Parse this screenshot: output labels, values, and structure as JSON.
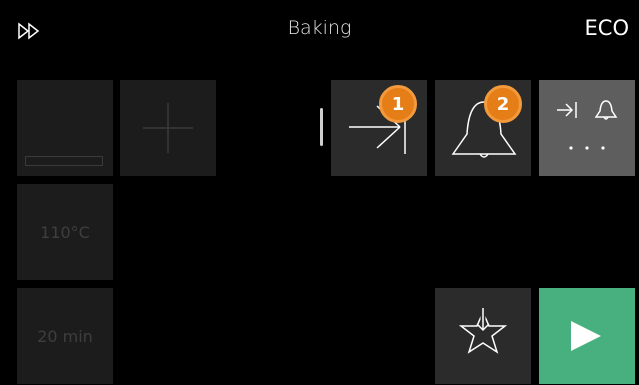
{
  "header": {
    "title": "Baking",
    "eco_label": "ECO",
    "fast_forward_icon": "fast-forward-icon"
  },
  "settings": {
    "temperature": "110°C",
    "duration": "20 min"
  },
  "badges": {
    "first": "1",
    "second": "2"
  },
  "actions": {
    "end_time_icon": "arrow-to-line-icon",
    "alarm_icon": "bell-icon",
    "more_options_icons": [
      "arrow-to-line-icon",
      "bell-icon"
    ],
    "favourite_icon": "star-download-icon",
    "start_icon": "play-icon"
  },
  "colors": {
    "background": "#000000",
    "tile_dark": "#1c1c1c",
    "tile_mid": "#2b2b2b",
    "tile_light": "#5e5e5e",
    "start_green": "#48b07e",
    "badge_orange": "#e67e18"
  }
}
